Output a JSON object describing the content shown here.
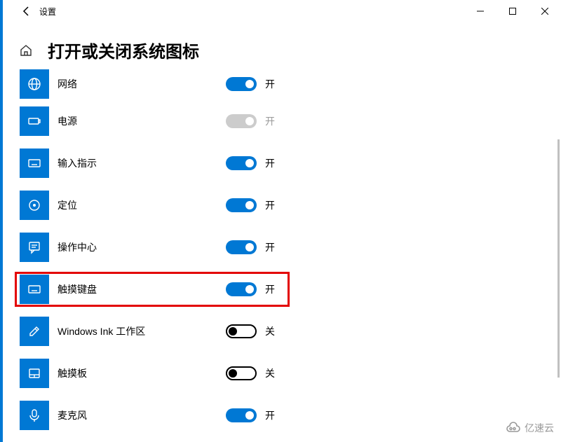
{
  "window": {
    "title": "设置",
    "page_title": "打开或关闭系统图标"
  },
  "state_labels": {
    "on": "开",
    "off": "关"
  },
  "items": [
    {
      "id": "network",
      "label": "网络",
      "state": "on",
      "icon": "globe"
    },
    {
      "id": "power",
      "label": "电源",
      "state": "disabled",
      "icon": "battery"
    },
    {
      "id": "input",
      "label": "输入指示",
      "state": "on",
      "icon": "keyboard"
    },
    {
      "id": "location",
      "label": "定位",
      "state": "on",
      "icon": "target"
    },
    {
      "id": "action",
      "label": "操作中心",
      "state": "on",
      "icon": "message"
    },
    {
      "id": "touchkb",
      "label": "触摸键盘",
      "state": "on",
      "icon": "keyboard",
      "highlight": true
    },
    {
      "id": "ink",
      "label": "Windows Ink 工作区",
      "state": "off",
      "icon": "pen"
    },
    {
      "id": "touchpad",
      "label": "触摸板",
      "state": "off",
      "icon": "touchpad"
    },
    {
      "id": "mic",
      "label": "麦克风",
      "state": "on",
      "icon": "mic"
    }
  ],
  "watermark": "亿速云"
}
